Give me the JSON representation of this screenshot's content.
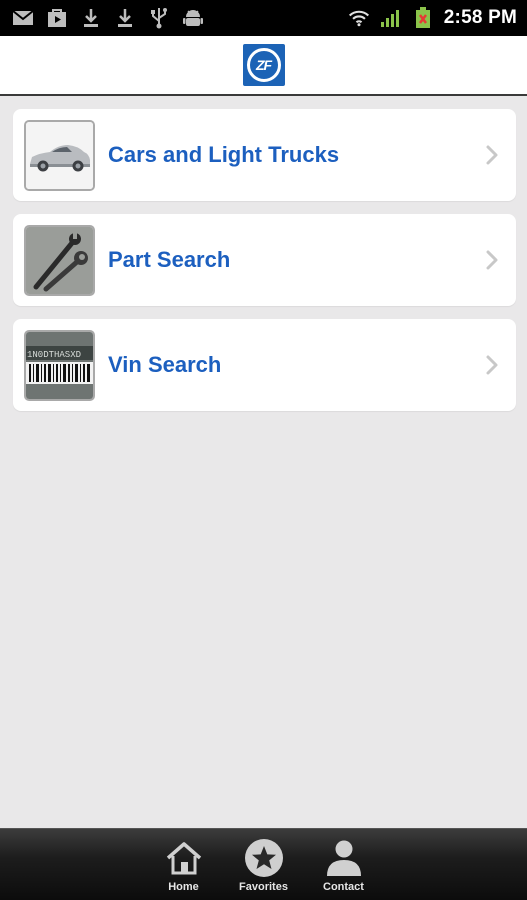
{
  "status_bar": {
    "time": "2:58 PM",
    "left_icons": [
      "gmail-icon",
      "play-store-icon",
      "download-icon",
      "download-icon",
      "usb-icon",
      "android-icon"
    ],
    "right_icons": [
      "wifi-icon",
      "signal-icon",
      "battery-charging-icon"
    ]
  },
  "header": {
    "logo_text": "ZF",
    "brand_color": "#1c63b6"
  },
  "menu": {
    "items": [
      {
        "label": "Cars and Light Trucks",
        "thumb": "car-thumbnail"
      },
      {
        "label": "Part Search",
        "thumb": "wrench-thumbnail"
      },
      {
        "label": "Vin Search",
        "thumb": "barcode-thumbnail",
        "thumb_text": "1N0DTHASXD"
      }
    ],
    "label_color": "#1c5fbf"
  },
  "tabbar": {
    "tabs": [
      {
        "label": "Home",
        "icon": "home-icon"
      },
      {
        "label": "Favorites",
        "icon": "star-icon"
      },
      {
        "label": "Contact",
        "icon": "person-icon"
      }
    ]
  }
}
